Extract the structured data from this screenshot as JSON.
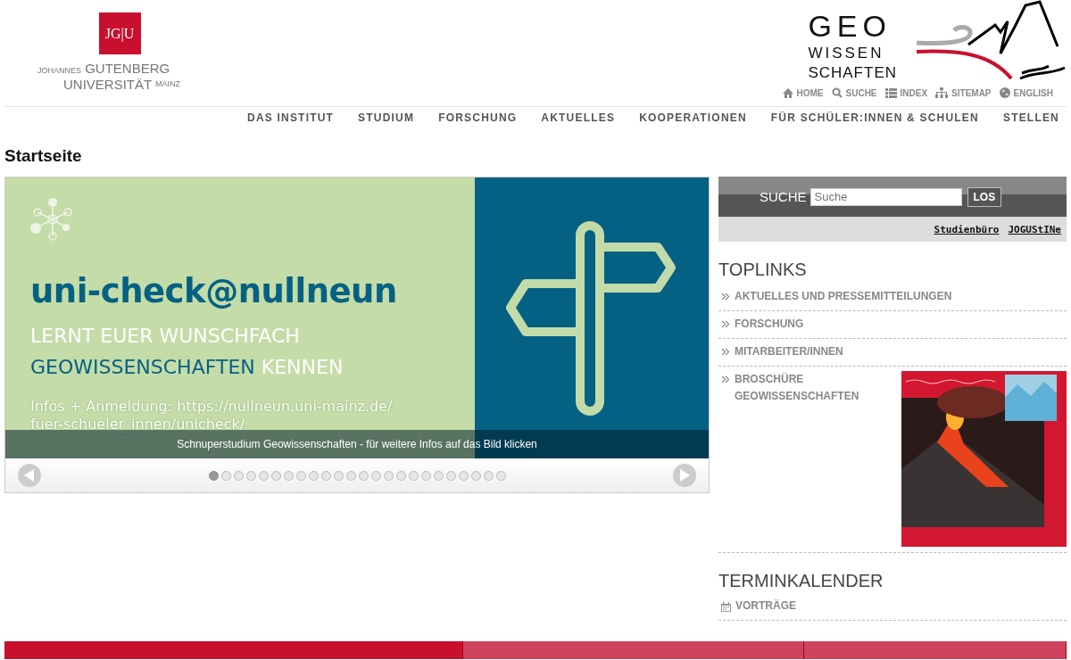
{
  "university_logo": {
    "mark": "JG|U",
    "line_1_small": "JOHANNES",
    "line_1": "GUTENBERG",
    "line_2": "UNIVERSITÄT",
    "line_2_small": "MAINZ"
  },
  "department_logo": {
    "line_1": "GEO",
    "line_2": "WISSEN",
    "line_3": "SCHAFTEN"
  },
  "service_links": [
    {
      "label": "HOME"
    },
    {
      "label": "SUCHE"
    },
    {
      "label": "INDEX"
    },
    {
      "label": "SITEMAP"
    },
    {
      "label": "ENGLISH"
    }
  ],
  "main_nav": [
    "DAS INSTITUT",
    "STUDIUM",
    "FORSCHUNG",
    "AKTUELLES",
    "KOOPERATIONEN",
    "FÜR SCHÜLER:INNEN & SCHULEN",
    "STELLEN"
  ],
  "page_title": "Startseite",
  "slider": {
    "headline": "uni-check@nullneun",
    "line_1": "LERNT EUER WUNSCHFACH",
    "line_2_highlight": "GEOWISSENSCHAFTEN",
    "line_2_rest": "KENNEN",
    "info_line_1": "Infos + Anmeldung: https://nullneun.uni-mainz.de/",
    "info_line_2": "fuer-schueler_innen/unicheck/",
    "caption": "Schnuperstudium Geowissenschaften - für weitere Infos auf das Bild klicken",
    "dots": [
      {
        "selected": true
      },
      {
        "selected": false
      },
      {
        "selected": false
      },
      {
        "selected": false
      },
      {
        "selected": false
      },
      {
        "selected": false
      },
      {
        "selected": false
      },
      {
        "selected": false
      },
      {
        "selected": false
      },
      {
        "selected": false
      },
      {
        "selected": false
      },
      {
        "selected": false
      },
      {
        "selected": false
      },
      {
        "selected": false
      },
      {
        "selected": false
      },
      {
        "selected": false
      },
      {
        "selected": false
      },
      {
        "selected": false
      },
      {
        "selected": false
      },
      {
        "selected": false
      },
      {
        "selected": false
      },
      {
        "selected": false
      },
      {
        "selected": false
      },
      {
        "selected": false
      }
    ]
  },
  "search": {
    "label": "SUCHE",
    "placeholder": "Suche",
    "button": "LOS"
  },
  "quick_links": [
    "Studienbüro",
    "JOGUStINe"
  ],
  "toplinks": {
    "title": "TOPLINKS",
    "items": [
      {
        "label": "AKTUELLES UND PRESSEMITTEILUNGEN"
      },
      {
        "label": "FORSCHUNG"
      },
      {
        "label": "MITARBEITER/INNEN"
      },
      {
        "label": "BROSCHÜRE GEOWISSENSCHAFTEN",
        "kind": "picture"
      }
    ]
  },
  "calendar": {
    "title": "TERMINKALENDER",
    "items": [
      "VORTRÄGE"
    ]
  },
  "footer_tabs": [
    {
      "color": "#c8102e"
    },
    {
      "color": "#d0435e"
    },
    {
      "color": "#d0435e"
    }
  ]
}
